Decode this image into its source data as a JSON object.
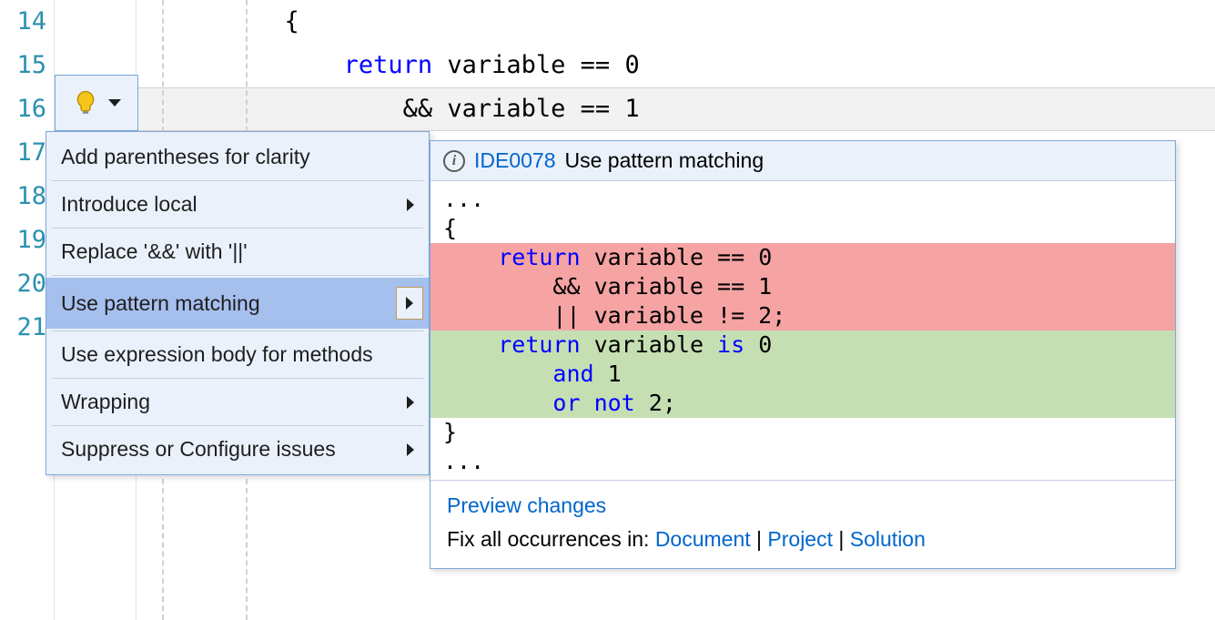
{
  "gutter_lines": [
    "14",
    "15",
    "16",
    "17",
    "18",
    "19",
    "20",
    "21"
  ],
  "code": {
    "line14": "          {",
    "line15_pre": "              ",
    "line15_kw": "return",
    "line15_rest": " variable == 0",
    "line16": "                  && variable == 1"
  },
  "menu": {
    "items": [
      {
        "label": "Add parentheses for clarity",
        "submenu": false
      },
      {
        "label": "Introduce local",
        "submenu": true
      },
      {
        "label": "Replace '&&' with '||'",
        "submenu": false
      },
      {
        "label": "Use pattern matching",
        "submenu": true,
        "selected": true
      },
      {
        "label": "Use expression body for methods",
        "submenu": false
      },
      {
        "label": "Wrapping",
        "submenu": true
      },
      {
        "label": "Suppress or Configure issues",
        "submenu": true
      }
    ]
  },
  "preview": {
    "diag_id": "IDE0078",
    "diag_text": "Use pattern matching",
    "diff": {
      "pre1": "...",
      "pre2": "{",
      "d1_pre": "    ",
      "d1_kw": "return",
      "d1_rest": " variable == 0",
      "d2": "        && variable == 1",
      "d3": "        || variable != 2;",
      "a1_pre": "    ",
      "a1_kw": "return",
      "a1_rest1": " variable ",
      "a1_kw2": "is",
      "a1_rest2": " 0",
      "a2_pre": "        ",
      "a2_kw": "and",
      "a2_rest": " 1",
      "a3_pre": "        ",
      "a3_kw": "or not",
      "a3_rest": " 2;",
      "post1": "}",
      "post2": "..."
    },
    "footer": {
      "preview_changes": "Preview changes",
      "fix_label": "Fix all occurrences in: ",
      "doc": "Document",
      "proj": "Project",
      "sol": "Solution",
      "sep": " | "
    }
  }
}
